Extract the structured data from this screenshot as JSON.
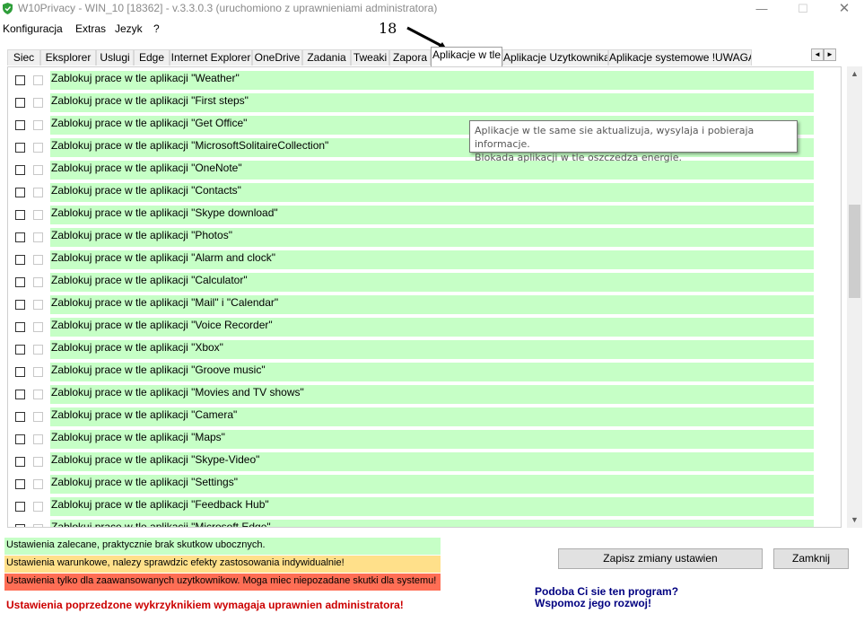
{
  "window": {
    "title": "W10Privacy - WIN_10 [18362]  - v.3.3.0.3 (uruchomiono z uprawnieniami administratora)",
    "minimize_glyph": "—",
    "maximize_glyph": "☐",
    "close_glyph": "✕"
  },
  "menu": [
    "Konfiguracja",
    "Extras",
    "Jezyk",
    "?"
  ],
  "annotation": {
    "number": "18"
  },
  "tabs": [
    {
      "label": "Siec"
    },
    {
      "label": "Eksplorer"
    },
    {
      "label": "Uslugi"
    },
    {
      "label": "Edge"
    },
    {
      "label": "Internet Explorer"
    },
    {
      "label": "OneDrive"
    },
    {
      "label": "Zadania"
    },
    {
      "label": "Tweaki"
    },
    {
      "label": "Zapora"
    },
    {
      "label": "Aplikacje w tle",
      "active": true
    },
    {
      "label": "Aplikacje Uzytkownika"
    },
    {
      "label": "Aplikacje systemowe !UWAGA!"
    }
  ],
  "tab_scroll": {
    "left": "◄",
    "right": "►"
  },
  "rows": [
    "Zablokuj prace w tle aplikacji \"Weather\"",
    "Zablokuj prace w tle aplikacji \"First steps\"",
    "Zablokuj prace w tle aplikacji \"Get Office\"",
    "Zablokuj prace w tle aplikacji \"MicrosoftSolitaireCollection\"",
    "Zablokuj prace w tle aplikacji \"OneNote\"",
    "Zablokuj prace w tle aplikacji \"Contacts\"",
    "Zablokuj prace w tle aplikacji \"Skype download\"",
    "Zablokuj prace w tle aplikacji \"Photos\"",
    "Zablokuj prace w tle aplikacji \"Alarm and clock\"",
    "Zablokuj prace w tle aplikacji \"Calculator\"",
    "Zablokuj prace w tle aplikacji \"Mail\" i \"Calendar\"",
    "Zablokuj prace w tle aplikacji \"Voice Recorder\"",
    "Zablokuj prace w tle aplikacji \"Xbox\"",
    "Zablokuj prace w tle aplikacji \"Groove music\"",
    "Zablokuj prace w tle aplikacji \"Movies and TV shows\"",
    "Zablokuj prace w tle aplikacji \"Camera\"",
    "Zablokuj prace w tle aplikacji \"Maps\"",
    "Zablokuj prace w tle aplikacji \"Skype-Video\"",
    "Zablokuj prace w tle aplikacji \"Settings\"",
    "Zablokuj prace w tle aplikacji \"Feedback Hub\"",
    "Zablokuj prace w tle aplikacji \"Microsoft Edge\""
  ],
  "tooltip": {
    "line1": "Aplikacje w tle same sie aktualizuja, wysylaja i pobieraja informacje.",
    "line2": "Blokada aplikacji w tle oszczedza energie."
  },
  "scrollbar": {
    "up_glyph": "▲",
    "down_glyph": "▼"
  },
  "legend": {
    "green": "Ustawienia zalecane, praktycznie brak skutkow ubocznych.",
    "yellow": "Ustawienia warunkowe, nalezy sprawdzic efekty zastosowania indywidualnie!",
    "red": "Ustawienia tylko dla zaawansowanych uzytkownikow. Moga miec niepozadane skutki dla systemu!"
  },
  "admin_note": "Ustawienia poprzedzone wykrzyknikiem wymagaja uprawnien administratora!",
  "buttons": {
    "save": "Zapisz zmiany ustawien",
    "close": "Zamknij"
  },
  "support": {
    "line1": "Podoba Ci sie ten program?",
    "line2": "Wspomoz jego rozwoj!"
  },
  "colors": {
    "recommended": "#c6ffc6",
    "conditional": "#ffe08a",
    "advanced": "#ff6e55",
    "admin_text": "#cc0000",
    "support_text": "#000080"
  }
}
